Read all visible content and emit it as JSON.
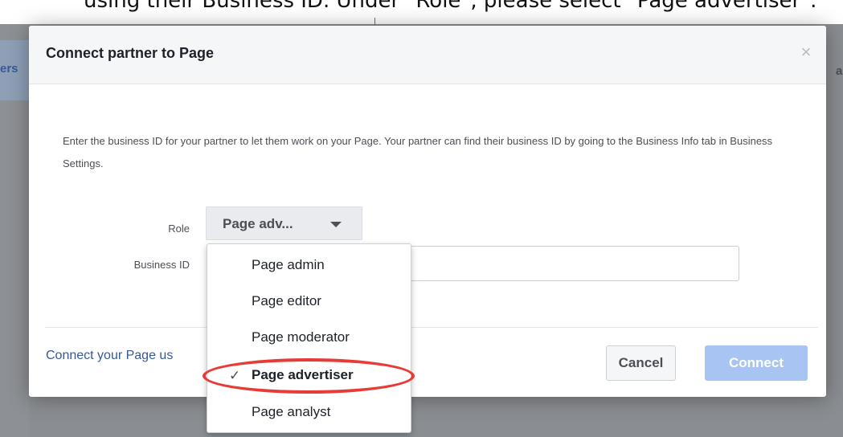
{
  "background": {
    "caption": "using their Business ID. Under \"Role\", please select \"Page advertiser\".",
    "left_tab_text": "ers",
    "right_edge_text": "a"
  },
  "dialog": {
    "title": "Connect partner to Page",
    "close_glyph": "×",
    "description": "Enter the business ID for your partner to let them work on your Page. Your partner can find their business ID by going to the Business Info tab in Business Settings.",
    "role_label": "Role",
    "role_value": "Page adv...",
    "business_id_label": "Business ID",
    "business_id_value": "",
    "footer_link": "Connect your Page us",
    "cancel_label": "Cancel",
    "connect_label": "Connect"
  },
  "role_menu": {
    "items": [
      {
        "label": "Page admin",
        "selected": false
      },
      {
        "label": "Page editor",
        "selected": false
      },
      {
        "label": "Page moderator",
        "selected": false
      },
      {
        "label": "Page advertiser",
        "selected": true
      },
      {
        "label": "Page analyst",
        "selected": false
      }
    ],
    "check_glyph": "✓"
  },
  "annotation": {
    "highlight_color": "#e83b36"
  },
  "colors": {
    "link": "#365899",
    "connect_button": "#a7c4f3",
    "overlay": "#8a8d91"
  }
}
